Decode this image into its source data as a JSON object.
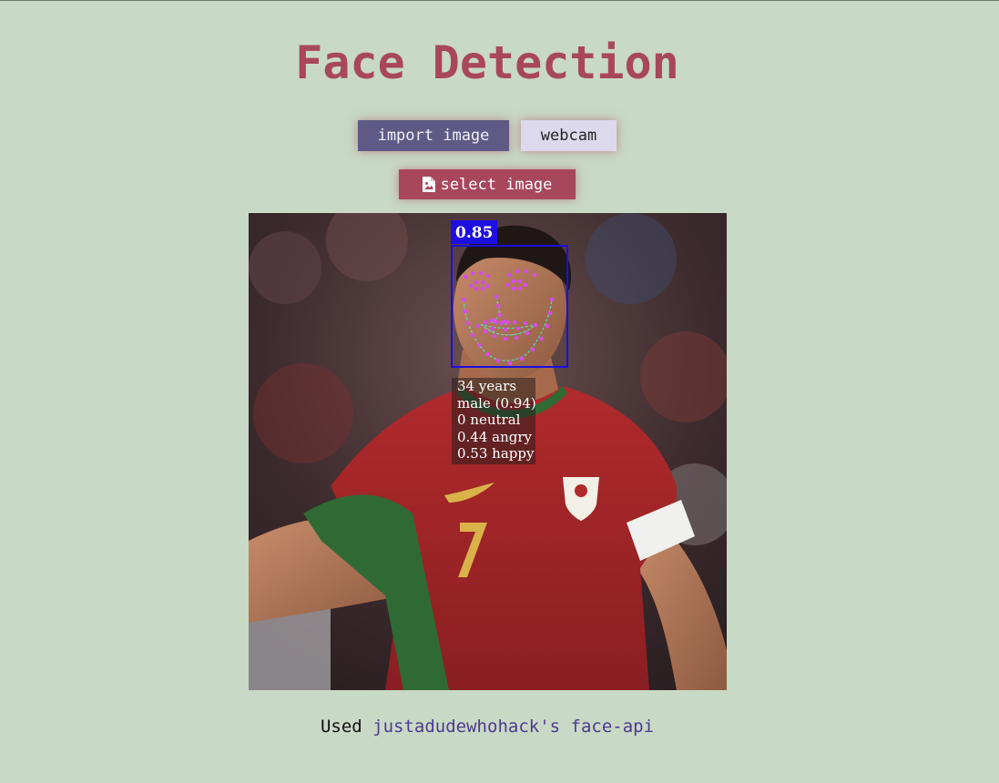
{
  "title": "Face Detection",
  "buttons": {
    "import_label": "import image",
    "webcam_label": "webcam",
    "select_label": "select image"
  },
  "detection": {
    "score": "0.85",
    "info": [
      "34 years",
      "male (0.94)",
      "0 neutral",
      "0.44 angry",
      "0.53 happy"
    ]
  },
  "footer": {
    "prefix": "Used",
    "link_text": "justadudewhohack's face-api"
  },
  "colors": {
    "background": "#c8d9c5",
    "accent": "#a8475c",
    "import_button": "#5f5a85",
    "webcam_button": "#dcd8ee",
    "box": "#1e0ee0",
    "landmarks": "#d64ce8"
  }
}
